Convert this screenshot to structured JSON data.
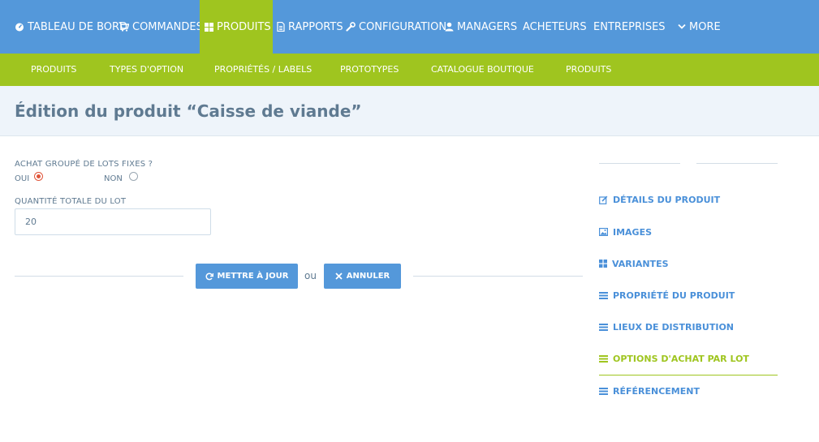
{
  "topnav": {
    "items": [
      {
        "label": "TABLEAU DE BORD",
        "icon": "dashboard-icon",
        "active": false
      },
      {
        "label": "COMMANDES",
        "icon": "cart-icon",
        "active": false
      },
      {
        "label": "PRODUITS",
        "icon": "grid-icon",
        "active": true
      },
      {
        "label": "RAPPORTS",
        "icon": "document-icon",
        "active": false
      },
      {
        "label": "CONFIGURATION",
        "icon": "wrench-icon",
        "active": false
      },
      {
        "label": "MANAGERS",
        "icon": "user-icon",
        "active": false
      },
      {
        "label": "ACHETEURS",
        "icon": "",
        "active": false
      },
      {
        "label": "ENTREPRISES",
        "icon": "",
        "active": false
      },
      {
        "label": "MORE",
        "icon": "chevron-down-icon",
        "active": false
      }
    ]
  },
  "subnav": {
    "items": [
      {
        "label": "PRODUITS",
        "active": true
      },
      {
        "label": "TYPES D'OPTION",
        "active": false
      },
      {
        "label": "PROPRIÉTÉS / LABELS",
        "active": false
      },
      {
        "label": "PROTOTYPES",
        "active": false
      },
      {
        "label": "CATALOGUE BOUTIQUE",
        "active": false
      },
      {
        "label": "PRODUITS",
        "active": true
      }
    ]
  },
  "page": {
    "title": "Édition du produit “Caisse de viande”"
  },
  "form": {
    "group_label": "ACHAT GROUPÉ DE LOTS FIXES ?",
    "options": [
      {
        "label": "OUI",
        "selected": true
      },
      {
        "label": "NON",
        "selected": false
      }
    ],
    "quantity_label": "QUANTITÉ TOTALE DU LOT",
    "quantity_value": "20",
    "update_button": "METTRE À JOUR",
    "or_text": "ou",
    "cancel_button": "ANNULER"
  },
  "sidebar": {
    "items": [
      {
        "label": "DÉTAILS DU PRODUIT",
        "icon": "edit-icon",
        "active": false
      },
      {
        "label": "IMAGES",
        "icon": "image-icon",
        "active": false
      },
      {
        "label": "VARIANTES",
        "icon": "grid-icon",
        "active": false
      },
      {
        "label": "PROPRIÉTÉ DU PRODUIT",
        "icon": "list-icon",
        "active": false
      },
      {
        "label": "LIEUX DE DISTRIBUTION",
        "icon": "list-icon",
        "active": false
      },
      {
        "label": "OPTIONS D'ACHAT PAR LOT",
        "icon": "list-icon",
        "active": true
      },
      {
        "label": "RÉFÉRENCEMENT",
        "icon": "list-icon",
        "active": false
      }
    ]
  },
  "colors": {
    "primary_blue": "#5498da",
    "accent_green": "#9fc51f",
    "text_slate": "#5f7a91",
    "radio_selected": "#e0553a"
  }
}
